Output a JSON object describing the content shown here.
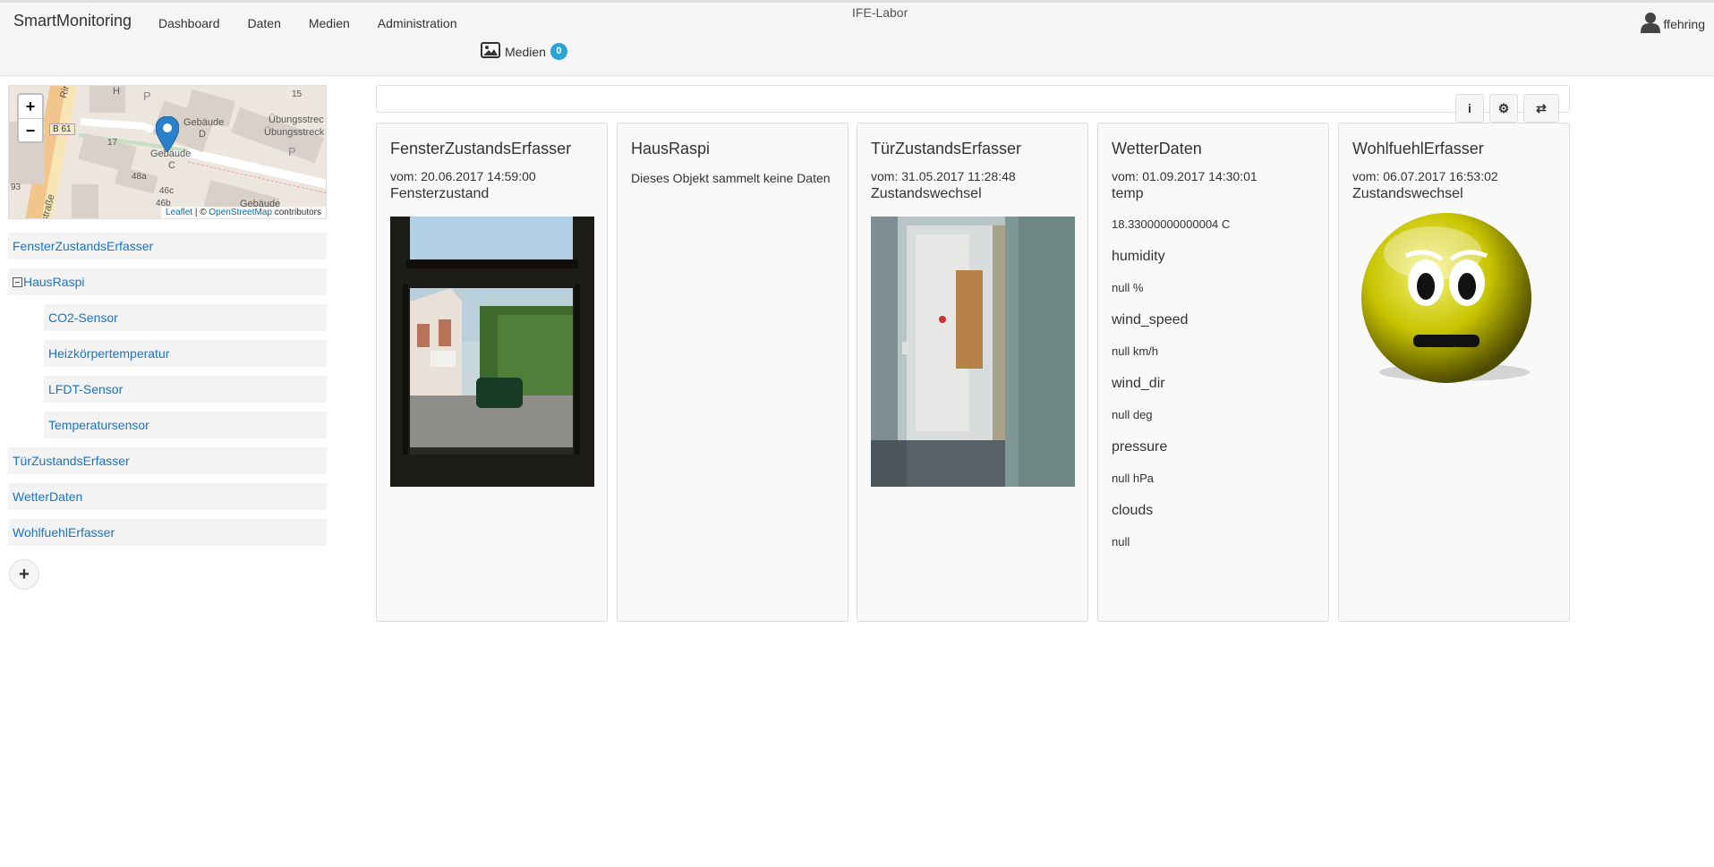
{
  "header": {
    "brand": "SmartMonitoring",
    "nav": [
      "Dashboard",
      "Daten",
      "Medien",
      "Administration"
    ],
    "center_title": "IFE-Labor",
    "user": "ffehring",
    "media_label": "Medien",
    "media_count": "0"
  },
  "map": {
    "zoom_in": "+",
    "zoom_out": "−",
    "attribution_leaflet": "Leaflet",
    "attribution_sep": " | © ",
    "attribution_osm": "OpenStreetMap",
    "attribution_tail": " contributors",
    "labels": {
      "h": "H",
      "n15": "15",
      "b61": "B 61",
      "n17": "17",
      "geb_d": "Gebäude",
      "geb_d2": "D",
      "geb_c": "Gebäude",
      "geb_c2": "C",
      "n48a": "48a",
      "n46c": "46c",
      "n46b": "46b",
      "n93": "93",
      "uebung1": "Übungsstrec",
      "uebung2": "Übungsstreck",
      "ringstr": "Ringstr",
      "strasse": "straße",
      "geb_bottom": "Gebäude",
      "p": "P"
    }
  },
  "sidebar": {
    "items": [
      {
        "label": "FensterZustandsErfasser",
        "child": false
      },
      {
        "label": "HausRaspi",
        "child": false,
        "expanded": true
      },
      {
        "label": "CO2-Sensor",
        "child": true
      },
      {
        "label": "Heizkörpertemperatur",
        "child": true
      },
      {
        "label": "LFDT-Sensor",
        "child": true
      },
      {
        "label": "Temperatursensor",
        "child": true
      },
      {
        "label": "TürZustandsErfasser",
        "child": false
      },
      {
        "label": "WetterDaten",
        "child": false
      },
      {
        "label": "WohlfuehlErfasser",
        "child": false
      }
    ],
    "add_label": "+"
  },
  "toolbar": {
    "info_icon": "i",
    "settings_icon": "⚙",
    "swap_icon": "⇄"
  },
  "cards": [
    {
      "title": "FensterZustandsErfasser",
      "date": "vom: 20.06.2017 14:59:00",
      "subtitle": "Fensterzustand"
    },
    {
      "title": "HausRaspi",
      "nodata": "Dieses Objekt sammelt keine Daten"
    },
    {
      "title": "TürZustandsErfasser",
      "date": "vom: 31.05.2017 11:28:48",
      "subtitle": "Zustandswechsel"
    },
    {
      "title": "WetterDaten",
      "date": "vom: 01.09.2017 14:30:01",
      "fields": [
        {
          "name": "temp",
          "value": "18.33000000000004 C"
        },
        {
          "name": "humidity",
          "value": "null %"
        },
        {
          "name": "wind_speed",
          "value": "null km/h"
        },
        {
          "name": "wind_dir",
          "value": "null deg"
        },
        {
          "name": "pressure",
          "value": "null hPa"
        },
        {
          "name": "clouds",
          "value": "null"
        }
      ]
    },
    {
      "title": "WohlfuehlErfasser",
      "date": "vom: 06.07.2017 16:53:02",
      "subtitle": "Zustandswechsel"
    }
  ],
  "colors": {
    "link": "#1a74c7",
    "badge": "#2aa3d6",
    "marker": "#2a81cb",
    "emoticon": "#c8c400"
  }
}
